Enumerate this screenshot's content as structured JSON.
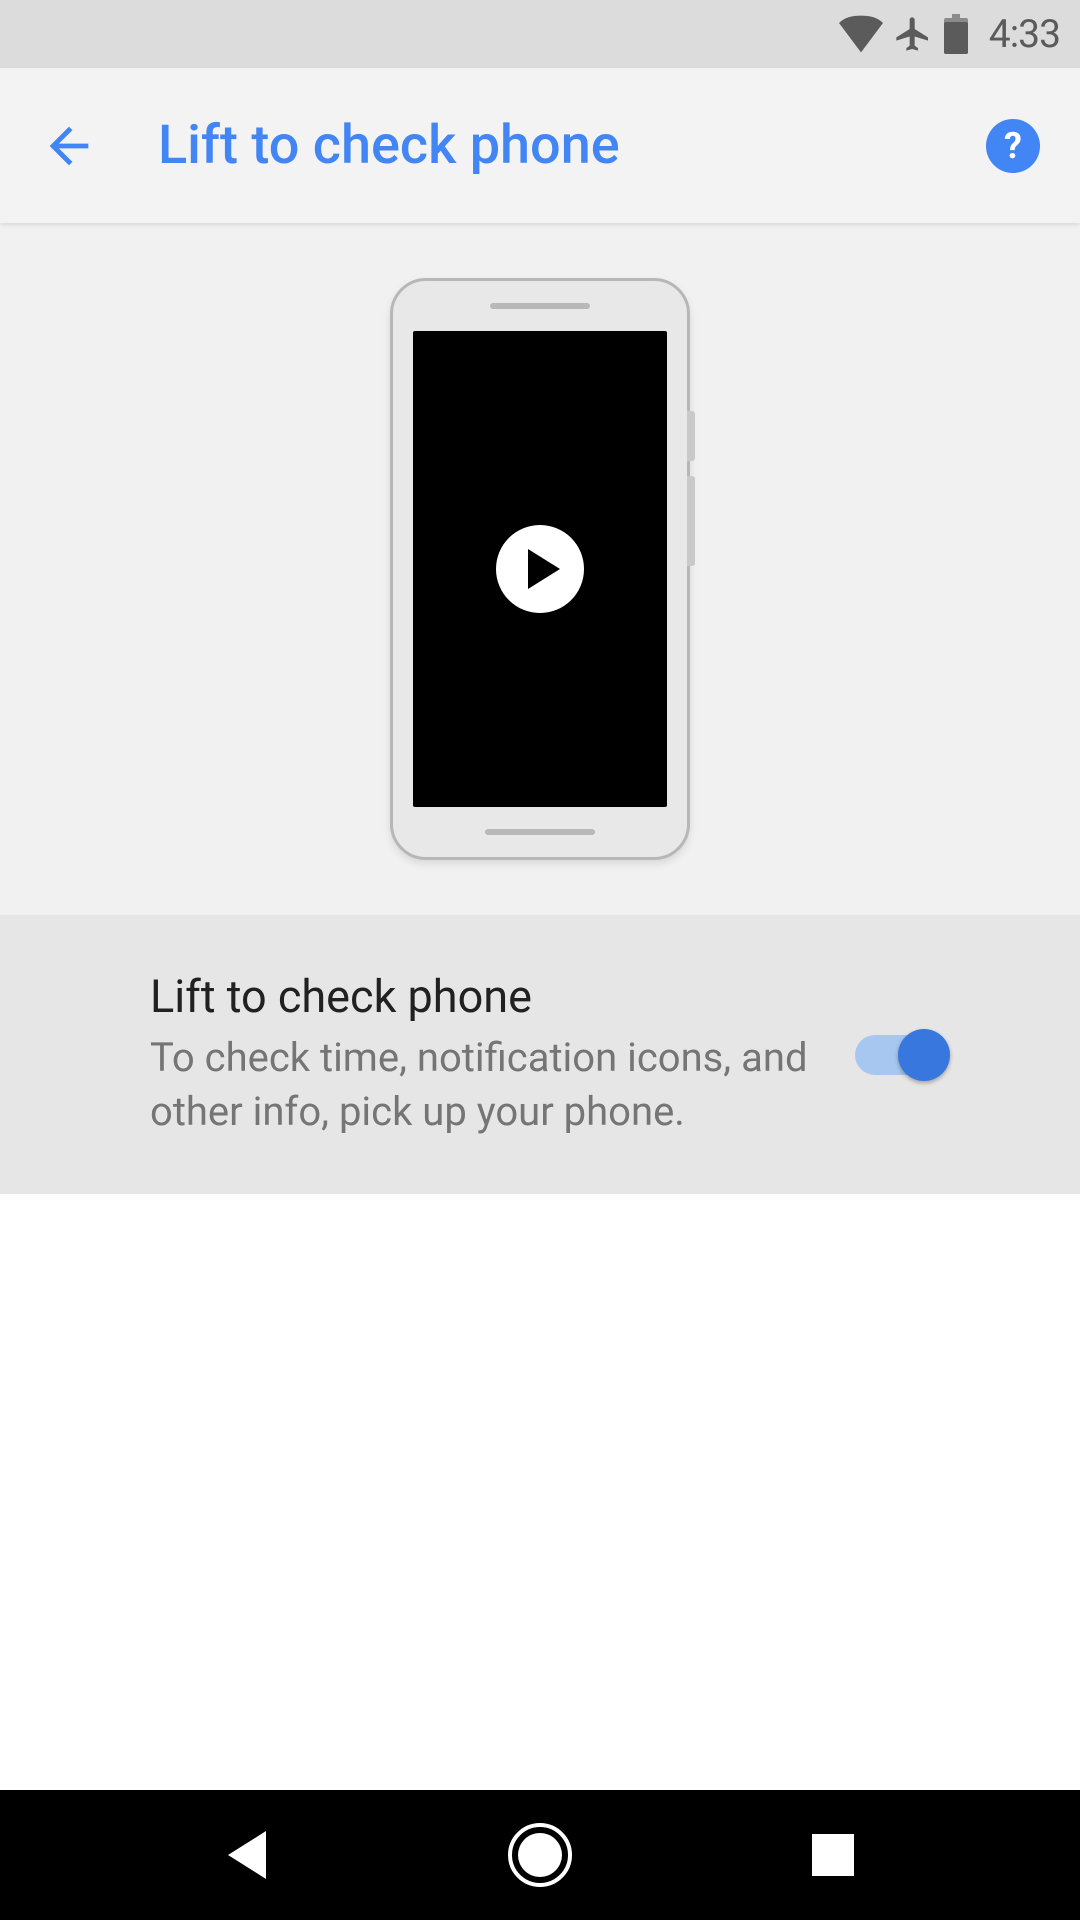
{
  "status_bar": {
    "time": "4:33"
  },
  "app_bar": {
    "title": "Lift to check phone",
    "help_label": "?"
  },
  "setting": {
    "title": "Lift to check phone",
    "description": "To check time, notification icons, and other info, pick up your phone.",
    "toggle_on": true
  },
  "colors": {
    "accent": "#4285f4"
  }
}
